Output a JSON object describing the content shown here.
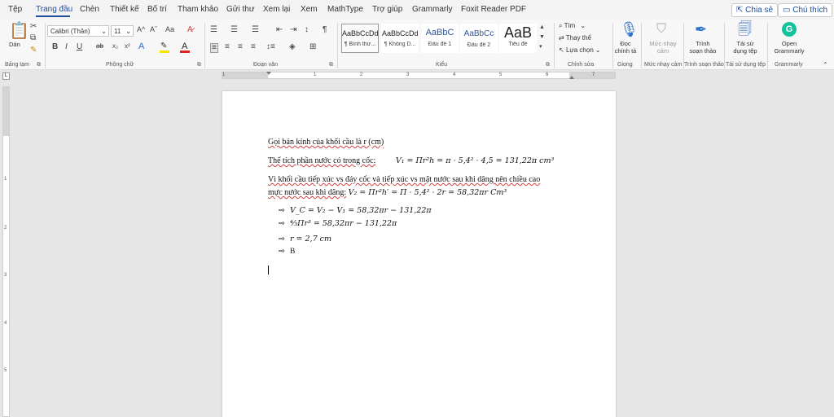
{
  "menu": {
    "tabs": [
      "Tệp",
      "Trang đầu",
      "Chèn",
      "Thiết kế",
      "Bố trí",
      "Tham khảo",
      "Gửi thư",
      "Xem lại",
      "Xem",
      "MathType",
      "Trợ giúp",
      "Grammarly",
      "Foxit Reader PDF"
    ],
    "active_tab": "Trang đầu",
    "share_label": "Chia sẻ",
    "comments_label": "Chú thích"
  },
  "ribbon": {
    "clipboard": {
      "paste_label": "Dán",
      "group_label": "Bảng tạm"
    },
    "font": {
      "font_name": "Calibri (Thân)",
      "font_size": "11",
      "grow_label": "A^",
      "shrink_label": "Aˇ",
      "case_label": "Aa",
      "bold": "B",
      "italic": "I",
      "underline": "U",
      "strike": "ab",
      "subscript": "x₂",
      "superscript": "x²",
      "group_label": "Phông chữ"
    },
    "paragraph": {
      "group_label": "Đoạn văn",
      "pilcrow": "¶"
    },
    "styles": {
      "items": [
        {
          "sample": "AaBbCcDd",
          "name": "¶ Bình thư..."
        },
        {
          "sample": "AaBbCcDd",
          "name": "¶ Không D..."
        },
        {
          "sample": "AaBbC",
          "name": "Đầu đề 1"
        },
        {
          "sample": "AaBbCc",
          "name": "Đầu đề 2"
        },
        {
          "sample": "AaB",
          "name": "Tiêu đề"
        }
      ],
      "group_label": "Kiểu"
    },
    "editing": {
      "find": "Tìm",
      "replace": "Thay thế",
      "select": "Lựa chọn",
      "group_label": "Chỉnh sửa"
    },
    "voice": {
      "label_line1": "Đọc",
      "label_line2": "chính tả",
      "group_label": "Giọng"
    },
    "sensitivity": {
      "label_line1": "Mức nhạy",
      "label_line2": "cảm",
      "group_label": "Mức nhạy cảm"
    },
    "editor": {
      "label_line1": "Trình",
      "label_line2": "soạn thảo",
      "group_label": "Trình soạn thảo"
    },
    "reuse": {
      "label_line1": "Tái sử",
      "label_line2": "dụng tệp",
      "group_label": "Tái sử dụng tệp"
    },
    "grammarly": {
      "label_line1": "Open",
      "label_line2": "Grammarly",
      "group_label": "Grammarly"
    }
  },
  "ruler": {
    "numbers": [
      "1",
      "1",
      "2",
      "3",
      "4",
      "5",
      "6",
      "7"
    ],
    "vnumbers": [
      "1",
      "2",
      "3",
      "4",
      "5"
    ],
    "corner": "L"
  },
  "document": {
    "line1": "Gọi bán kính của khối cầu là r (cm)",
    "line2_text": "Thể tích phần nước có trong cốc:",
    "line2_math": "V₁ = Πr²h = π · 5,4² · 4,5 = 131,22π cm³",
    "line3": "Vì khối cầu tiếp xúc vs đáy cốc và tiếp xúc vs mặt nước sau khi dâng nên chiều cao",
    "line4_text": "mực nước sau khi dâng:",
    "line4_math": "V₂ = Πr²h′ = Π · 5,4² · 2r = 58,32πr Cm³",
    "bullets": [
      "V_C = V₂ − V₁ = 58,32πr − 131,22π",
      "⁴⁄₃Πr³ = 58,32πr − 131,22π",
      "r = 2,7 cm",
      "B"
    ],
    "bullet_arrow": "⇨"
  }
}
